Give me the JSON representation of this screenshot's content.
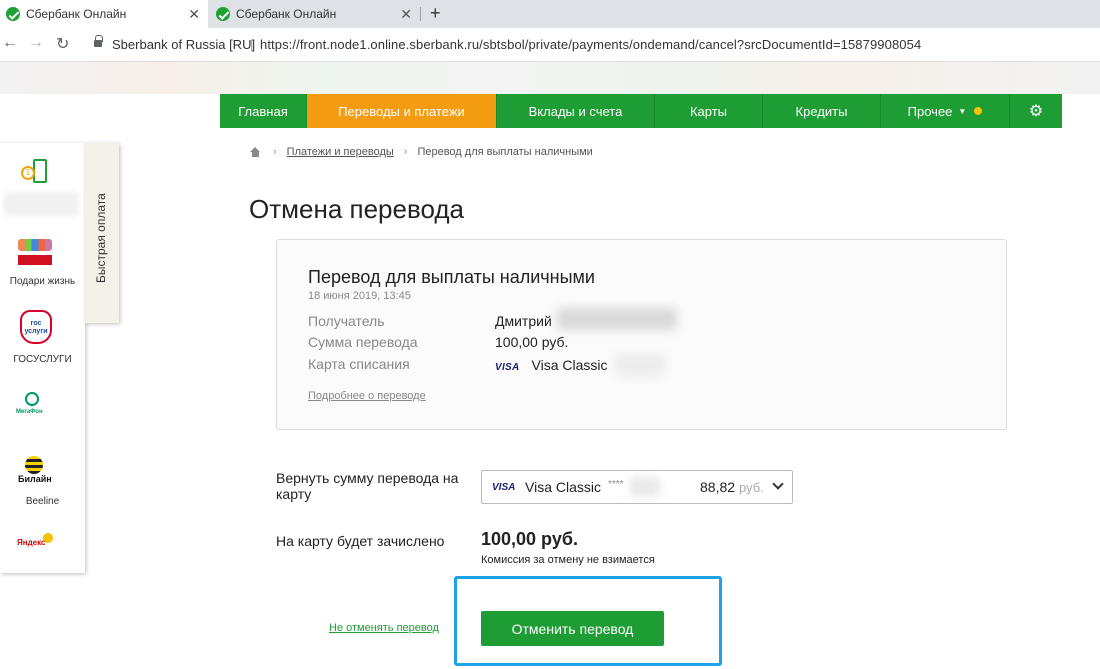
{
  "browser": {
    "tabs": [
      {
        "title": "Сбербанк Онлайн",
        "close": "✕"
      },
      {
        "title": "Сбербанк Онлайн",
        "close": "✕"
      }
    ],
    "new_tab": "+",
    "site_identity": "Sberbank of Russia [RU]",
    "url": "https://front.node1.online.sberbank.ru/sbtsbol/private/payments/ondemand/cancel?srcDocumentId=15879908054"
  },
  "nav": {
    "items": [
      "Главная",
      "Переводы и платежи",
      "Вклады и счета",
      "Карты",
      "Кредиты",
      "Прочее"
    ]
  },
  "breadcrumb": {
    "items": [
      "Платежи и переводы",
      "Перевод для выплаты наличными"
    ]
  },
  "quick_panel": {
    "tab_label": "Быстрая оплата",
    "items": [
      "Подари жизнь",
      "ГОСУСЛУГИ",
      "Beeline"
    ],
    "gos_text": "гос услуги",
    "megafon_text": "МегаФон",
    "bilain_text": "Билайн",
    "yandex_text": "Яндекс"
  },
  "page": {
    "title": "Отмена перевода"
  },
  "card": {
    "title": "Перевод для выплаты наличными",
    "date": "18 июня 2019, 13:45",
    "rows": [
      {
        "label": "Получатель",
        "value": "Дмитрий"
      },
      {
        "label": "Сумма перевода",
        "value": "100,00 руб."
      },
      {
        "label": "Карта списания",
        "value": "Visa Classic"
      }
    ],
    "visa_text": "VISA",
    "more_link": "Подробнее о переводе"
  },
  "return": {
    "label": "Вернуть сумму перевода на карту",
    "select": {
      "visa_text": "VISA",
      "card_name": "Visa Classic",
      "mask": "****",
      "balance": "88,82",
      "currency": "руб."
    }
  },
  "credited": {
    "label": "На карту будет зачислено",
    "amount": "100,00 руб.",
    "commission": "Комиссия за отмену не взимается"
  },
  "actions": {
    "dont_cancel": "Не отменять перевод",
    "cancel": "Отменить перевод"
  },
  "colors": {
    "brand_green": "#1f9d35",
    "active_orange": "#f39c12",
    "highlight_blue": "#1aa3e8"
  }
}
